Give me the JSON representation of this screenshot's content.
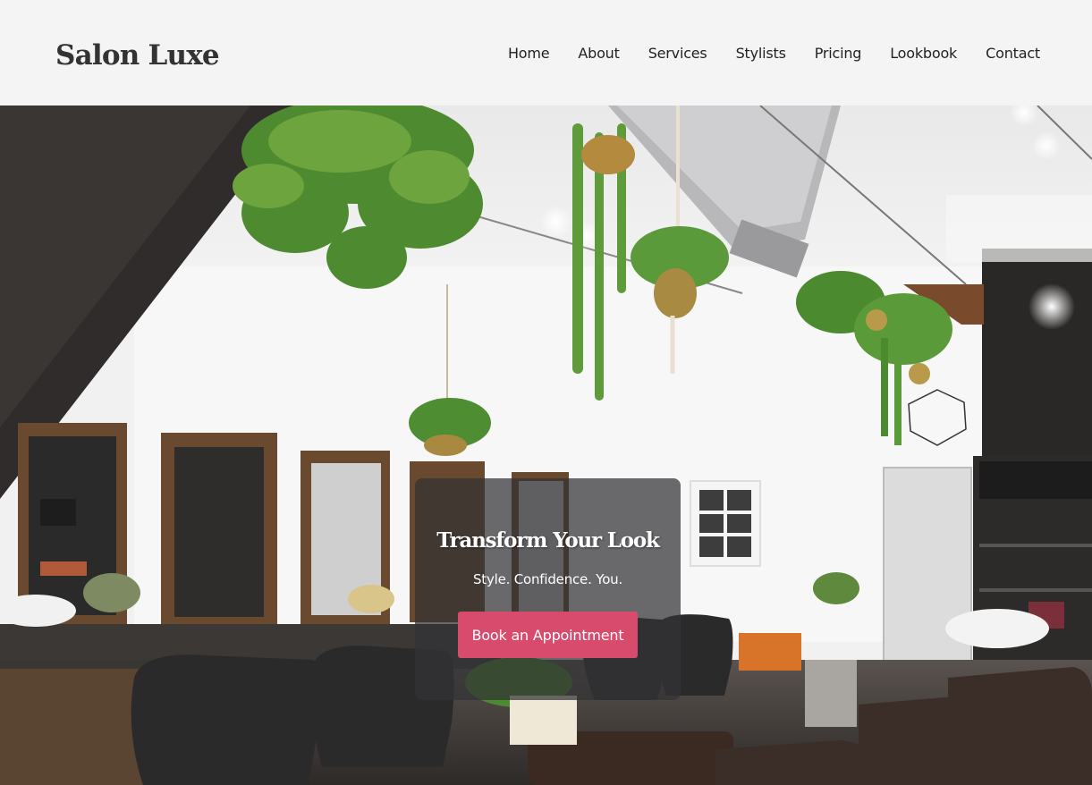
{
  "brand": {
    "name": "Salon Luxe"
  },
  "nav": {
    "items": [
      {
        "label": "Home"
      },
      {
        "label": "About"
      },
      {
        "label": "Services"
      },
      {
        "label": "Stylists"
      },
      {
        "label": "Pricing"
      },
      {
        "label": "Lookbook"
      },
      {
        "label": "Contact"
      }
    ]
  },
  "hero": {
    "title": "Transform Your Look",
    "subtitle": "Style. Confidence. You.",
    "cta_label": "Book an Appointment",
    "image": "salon-interior-photo"
  },
  "colors": {
    "header_bg": "#f4f4f4",
    "cta_bg": "#d84b6d",
    "text_dark": "#222222",
    "overlay_bg": "rgba(50,50,52,0.72)"
  }
}
